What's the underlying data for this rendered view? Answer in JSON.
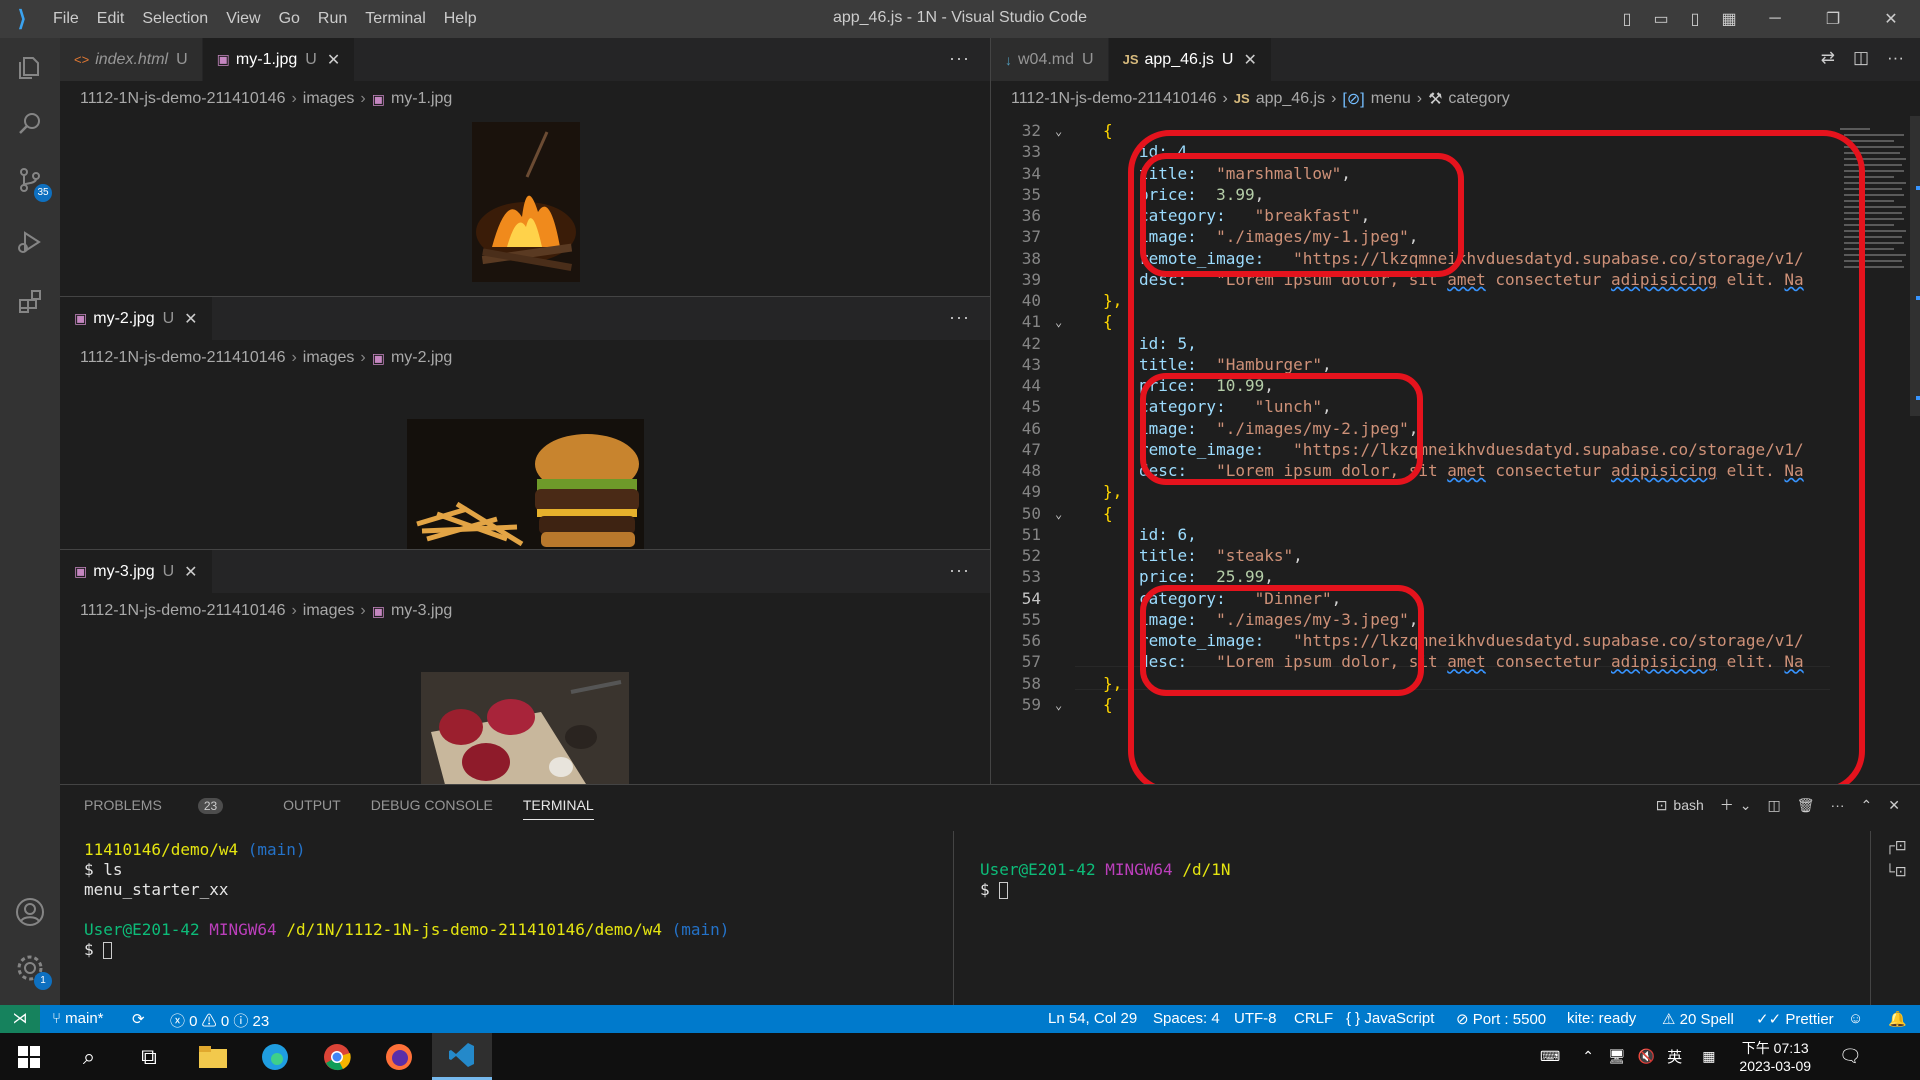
{
  "window": {
    "title": "app_46.js - 1N - Visual Studio Code"
  },
  "menu": [
    "File",
    "Edit",
    "Selection",
    "View",
    "Go",
    "Run",
    "Terminal",
    "Help"
  ],
  "activity": {
    "scm_badge": "35",
    "settings_badge": "1"
  },
  "left": {
    "tab_index": {
      "name": "index.html",
      "status": "U"
    },
    "tab_my1": {
      "name": "my-1.jpg",
      "status": "U"
    },
    "crumb1": {
      "root": "1112-1N-js-demo-211410146",
      "folder": "images",
      "file": "my-1.jpg"
    },
    "tab_my2": {
      "name": "my-2.jpg",
      "status": "U"
    },
    "crumb2": {
      "root": "1112-1N-js-demo-211410146",
      "folder": "images",
      "file": "my-2.jpg"
    },
    "tab_my3": {
      "name": "my-3.jpg",
      "status": "U"
    },
    "crumb3": {
      "root": "1112-1N-js-demo-211410146",
      "folder": "images",
      "file": "my-3.jpg"
    },
    "more": "···"
  },
  "right": {
    "tab_w04": {
      "name": "w04.md",
      "status": "U"
    },
    "tab_app": {
      "name": "app_46.js",
      "status": "U",
      "icon": "JS"
    },
    "crumb": {
      "root": "1112-1N-js-demo-211410146",
      "file": "app_46.js",
      "symbol1": "menu",
      "symbol2": "category"
    },
    "lines": [
      {
        "n": "32"
      },
      {
        "n": "33"
      },
      {
        "n": "34"
      },
      {
        "n": "35"
      },
      {
        "n": "36"
      },
      {
        "n": "37"
      },
      {
        "n": "38"
      },
      {
        "n": "39"
      },
      {
        "n": "40"
      },
      {
        "n": "41"
      },
      {
        "n": "42"
      },
      {
        "n": "43"
      },
      {
        "n": "44"
      },
      {
        "n": "45"
      },
      {
        "n": "46"
      },
      {
        "n": "47"
      },
      {
        "n": "48"
      },
      {
        "n": "49"
      },
      {
        "n": "50"
      },
      {
        "n": "51"
      },
      {
        "n": "52"
      },
      {
        "n": "53"
      },
      {
        "n": "54"
      },
      {
        "n": "55"
      },
      {
        "n": "56"
      },
      {
        "n": "57"
      },
      {
        "n": "58"
      },
      {
        "n": "59"
      }
    ],
    "code": {
      "l32": "{",
      "l33": "id: 4,",
      "l34a": "title:  ",
      "l34b": "\"marshmallow\"",
      "l34c": ",",
      "l35a": "price:  ",
      "l35b": "3.99",
      "l35c": ",",
      "l36a": "category:   ",
      "l36b": "\"breakfast\"",
      "l36c": ",",
      "l37a": "image:  ",
      "l37b": "\"./images/my-1.jpeg\"",
      "l37c": ",",
      "l38a": "remote_image:   ",
      "l38b": "\"https://lkzqmneikhvduesdatyd.supabase.co/storage/v1/",
      "l39a": "desc:   ",
      "l39b": "\"Lorem ipsum dolor, sit ",
      "l39c": "amet",
      "l39d": " consectetur ",
      "l39e": "adipisicing",
      "l39f": " elit. ",
      "l39g": "Na",
      "l40": "},",
      "l41": "{",
      "l42": "id: 5,",
      "l43a": "title:  ",
      "l43b": "\"Hamburger\"",
      "l43c": ",",
      "l44a": "price:  ",
      "l44b": "10.99",
      "l44c": ",",
      "l45a": "category:   ",
      "l45b": "\"lunch\"",
      "l45c": ",",
      "l46a": "image:  ",
      "l46b": "\"./images/my-2.jpeg\"",
      "l46c": ",",
      "l47a": "remote_image:   ",
      "l47b": "\"https://lkzqmneikhvduesdatyd.supabase.co/storage/v1/",
      "l48a": "desc:   ",
      "l48b": "\"Lorem ipsum dolor, sit ",
      "l48c": "amet",
      "l48d": " consectetur ",
      "l48e": "adipisicing",
      "l48f": " elit. ",
      "l48g": "Na",
      "l49": "},",
      "l50": "{",
      "l51": "id: 6,",
      "l52a": "title:  ",
      "l52b": "\"steaks\"",
      "l52c": ",",
      "l53a": "price:  ",
      "l53b": "25.99",
      "l53c": ",",
      "l54a": "category:   ",
      "l54b": "\"Dinner\"",
      "l54c": ",",
      "l55a": "image:  ",
      "l55b": "\"./images/my-3.jpeg\"",
      "l55c": ",",
      "l56a": "remote_image:   ",
      "l56b": "\"https://lkzqmneikhvduesdatyd.supabase.co/storage/v1/",
      "l57a": "desc:   ",
      "l57b": "\"Lorem ipsum dolor, sit ",
      "l57c": "amet",
      "l57d": " consectetur ",
      "l57e": "adipisicing",
      "l57f": " elit. ",
      "l57g": "Na",
      "l58": "},",
      "l59": "{"
    }
  },
  "panel": {
    "tabs": {
      "problems": "PROBLEMS",
      "problems_count": "23",
      "output": "OUTPUT",
      "debug": "DEBUG CONSOLE",
      "terminal": "TERMINAL"
    },
    "shell": "bash",
    "term1": {
      "path1": "11410146/demo/w4",
      "branch1": "(main)",
      "cmd": "$ ls",
      "out": "menu_starter_xx",
      "user": "User@E201-42",
      "env": "MINGW64",
      "path2": "/d/1N/1112-1N-js-demo-211410146/demo/w4",
      "branch2": "(main)",
      "prompt": "$ "
    },
    "term2": {
      "user": "User@E201-42",
      "env": "MINGW64",
      "path": "/d/1N",
      "prompt": "$ "
    }
  },
  "status": {
    "branch": "main*",
    "errors": "0",
    "warnings": "0",
    "infos": "23",
    "position": "Ln 54, Col 29",
    "spaces": "Spaces: 4",
    "encoding": "UTF-8",
    "eol": "CRLF",
    "language": "JavaScript",
    "port": "Port : 5500",
    "kite": "kite: ready",
    "spell": "20 Spell",
    "prettier": "Prettier"
  },
  "taskbar": {
    "time": "下午 07:13",
    "date": "2023-03-09",
    "ime": "英"
  }
}
